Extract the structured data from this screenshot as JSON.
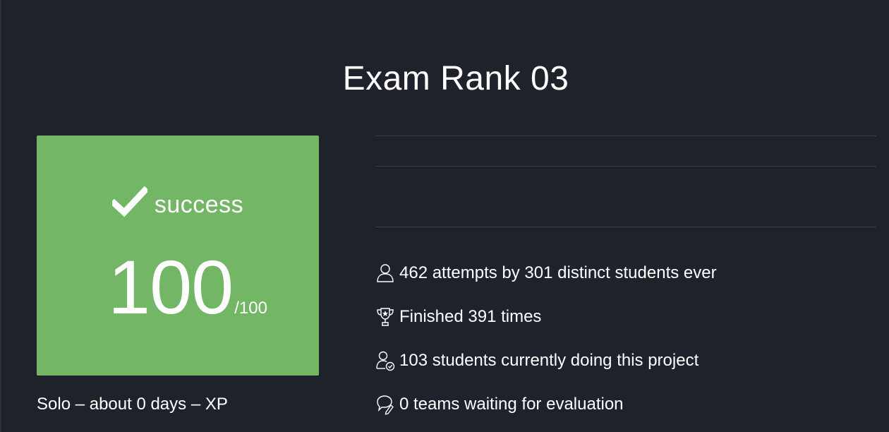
{
  "project": {
    "title": "Exam Rank 03"
  },
  "result": {
    "status_icon": "checkmark-icon",
    "status": "success",
    "score": "100",
    "max_score": "/100",
    "color": "#73b666"
  },
  "meta": {
    "text": "Solo – about 0 days – XP"
  },
  "stats": [
    {
      "icon": "user-icon",
      "text": "462 attempts by 301 distinct students ever"
    },
    {
      "icon": "trophy-icon",
      "text": "Finished 391 times"
    },
    {
      "icon": "user-in-progress-icon",
      "text": "103 students currently doing this project"
    },
    {
      "icon": "chat-bubbles-icon",
      "text": "0 teams waiting for evaluation"
    }
  ],
  "colors": {
    "background": "#1f222a",
    "success": "#73b666",
    "divider": "#3a3e47"
  }
}
